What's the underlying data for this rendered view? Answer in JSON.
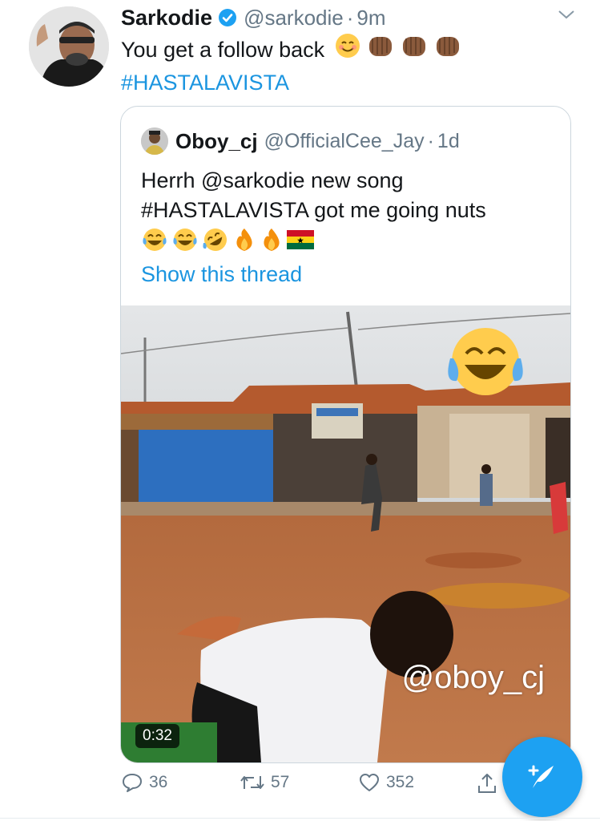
{
  "tweet": {
    "author_name": "Sarkodie",
    "author_handle": "@sarkodie",
    "separator": "·",
    "time": "9m",
    "text": "You get a follow back",
    "hashtag": "#HASTALAVISTA",
    "emojis": [
      "smiling-face",
      "fist-bump",
      "fist-bump",
      "fist-bump"
    ]
  },
  "quoted": {
    "author_name": "Oboy_cj",
    "author_handle": "@OfficialCee_Jay",
    "separator": "·",
    "time": "1d",
    "text_line1": "Herrh @sarkodie new song",
    "text_line2": "#HASTALAVISTA got me going nuts",
    "emojis": [
      "tears-of-joy",
      "tears-of-joy",
      "rolling-laughing",
      "fire",
      "fire",
      "ghana-flag"
    ],
    "show_thread": "Show this thread",
    "video": {
      "duration": "0:32",
      "watermark": "@oboy_cj",
      "overlay_emoji": "tears-of-joy"
    }
  },
  "actions": {
    "replies": "36",
    "retweets": "57",
    "likes": "352"
  },
  "colors": {
    "link": "#1b95e0",
    "secondary": "#657786",
    "accent": "#1da1f2"
  }
}
